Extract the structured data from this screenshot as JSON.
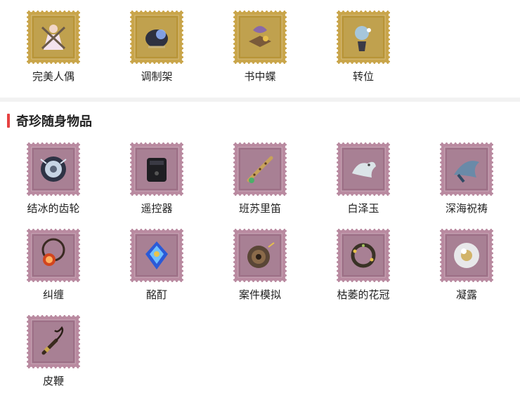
{
  "colors": {
    "gold_stamp_outer": "#c9a54a",
    "gold_stamp_inner": "#b89436",
    "purple_stamp_outer": "#b98aa0",
    "purple_stamp_inner": "#9d6f86",
    "section_accent": "#e64242",
    "divider": "#f2f2f2"
  },
  "top_items": [
    {
      "label": "完美人偶",
      "icon": "ballerina-doll-icon",
      "stamp": "gold"
    },
    {
      "label": "调制架",
      "icon": "mixing-stand-icon",
      "stamp": "gold"
    },
    {
      "label": "书中蝶",
      "icon": "book-butterfly-icon",
      "stamp": "gold"
    },
    {
      "label": "转位",
      "icon": "transposition-icon",
      "stamp": "gold"
    }
  ],
  "section": {
    "title": "奇珍随身物品"
  },
  "items": [
    {
      "label": "结冰的齿轮",
      "icon": "frozen-gear-icon",
      "stamp": "purple"
    },
    {
      "label": "遥控器",
      "icon": "remote-control-icon",
      "stamp": "purple"
    },
    {
      "label": "班苏里笛",
      "icon": "bansuri-flute-icon",
      "stamp": "purple"
    },
    {
      "label": "白泽玉",
      "icon": "baize-jade-icon",
      "stamp": "purple"
    },
    {
      "label": "深海祝祷",
      "icon": "deep-sea-prayer-icon",
      "stamp": "purple"
    },
    {
      "label": "纠缠",
      "icon": "entangle-pendant-icon",
      "stamp": "purple"
    },
    {
      "label": "酩酊",
      "icon": "blue-gem-icon",
      "stamp": "purple"
    },
    {
      "label": "案件模拟",
      "icon": "spinning-top-icon",
      "stamp": "purple"
    },
    {
      "label": "枯萎的花冠",
      "icon": "withered-wreath-icon",
      "stamp": "purple"
    },
    {
      "label": "凝露",
      "icon": "dew-pearl-icon",
      "stamp": "purple"
    },
    {
      "label": "皮鞭",
      "icon": "whip-icon",
      "stamp": "purple"
    }
  ]
}
